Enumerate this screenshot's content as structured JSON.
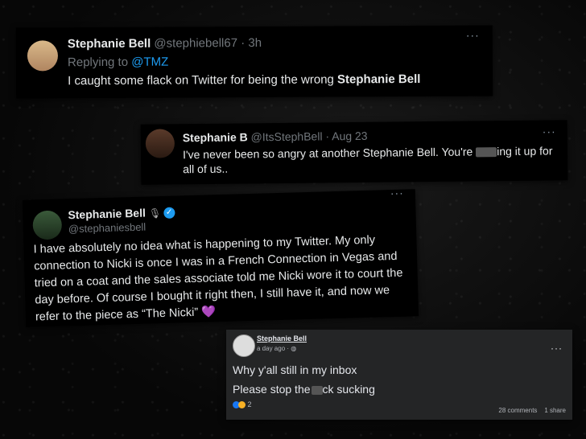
{
  "post1": {
    "name": "Stephanie Bell",
    "meta": "@stephiebell67 · 3h",
    "replying_label": "Replying to",
    "replying_handle": "@TMZ",
    "text_prefix": "I caught some flack on Twitter for being the wrong",
    "text_bold": "Stephanie Bell",
    "more": "···"
  },
  "post2": {
    "name": "Stephanie B",
    "meta": "@ItsStephBell · Aug 23",
    "text_before": "I've never been so angry at another Stephanie Bell. You're",
    "text_after": "ing it up for all of us..",
    "more": "···"
  },
  "post3": {
    "name": "Stephanie Bell",
    "handle": "@stephaniesbell",
    "text": "I have absolutely no idea what is happening to my Twitter. My only connection to Nicki is once I was in a French Connection in Vegas and tried on a coat and the sales associate told me Nicki wore it to court the day before. Of course I bought it right then, I still have it, and now we refer to the piece as “The Nicki”",
    "emoji": "💜",
    "more": "···",
    "verified_glyph": "✓"
  },
  "post4": {
    "name": "Stephanie Bell",
    "time": "a day ago · ",
    "line1": "Why y'all still in my inbox",
    "line2_before": "Please stop the",
    "line2_after": "ck sucking",
    "reaction_count": "2",
    "comments": "28 comments",
    "shares": "1 share",
    "more": "···"
  }
}
